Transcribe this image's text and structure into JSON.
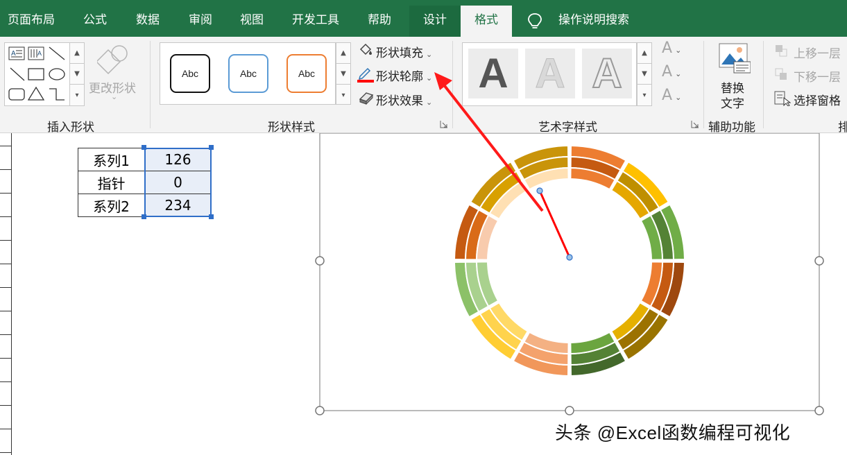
{
  "tabs": [
    "页面布局",
    "公式",
    "数据",
    "审阅",
    "视图",
    "开发工具",
    "帮助",
    "设计",
    "格式"
  ],
  "search_label": "操作说明搜索",
  "ribbon": {
    "insert_shapes": {
      "label": "插入形状",
      "change_shape": "更改形状"
    },
    "shape_styles": {
      "label": "形状样式",
      "samples": [
        "Abc",
        "Abc",
        "Abc"
      ],
      "fill": "形状填充",
      "outline": "形状轮廓",
      "effects": "形状效果"
    },
    "wordart": {
      "label": "艺术字样式",
      "glyph": "A"
    },
    "accessibility": {
      "label": "辅助功能",
      "alt_text": [
        "替换",
        "文字"
      ]
    },
    "arrange": {
      "bring_forward": "上移一层",
      "send_backward": "下移一层",
      "selection_pane": "选择窗格",
      "label_partial": "排"
    }
  },
  "table": [
    {
      "label": "系列1",
      "value": "126"
    },
    {
      "label": "指针",
      "value": "0"
    },
    {
      "label": "系列2",
      "value": "234"
    }
  ],
  "watermark": "头条 @Excel函数编程可视化",
  "colors": {
    "excel_green": "#217346",
    "ring_palette": [
      "#ED7D31",
      "#FFC000",
      "#70AD47",
      "#C55A11",
      "#BF8F00",
      "#548235",
      "#F4B183",
      "#FFD966",
      "#A9D18E"
    ],
    "pointer": "#FF0000"
  }
}
